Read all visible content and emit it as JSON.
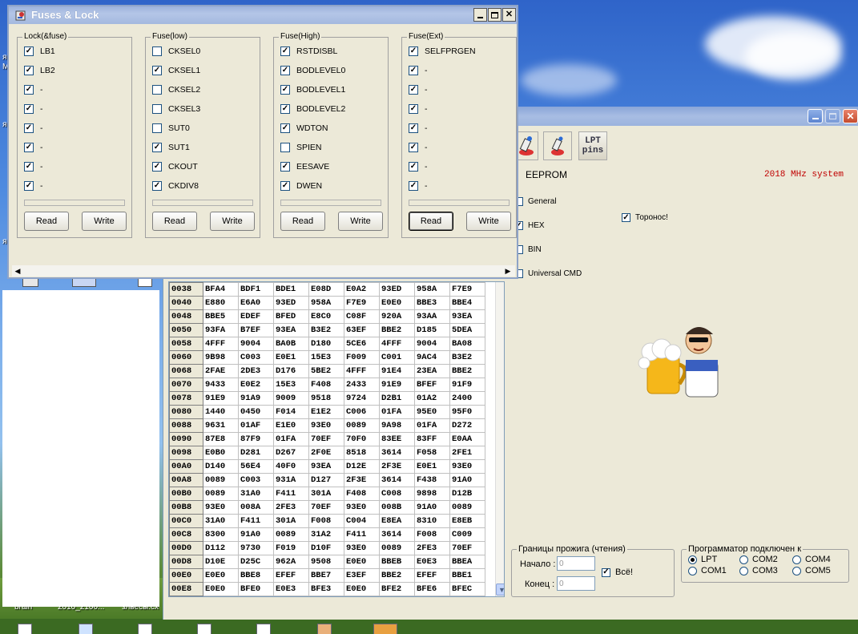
{
  "desktop": {
    "icon_labels": [
      "brain",
      "2010_2100...",
      "злвесы.сх"
    ],
    "side_letters": [
      "я",
      "M",
      "я",
      "я"
    ]
  },
  "main_window": {
    "toolbar": {
      "lpt_line1": "LPT",
      "lpt_line2": "pins"
    },
    "eeprom_label": "EEPROM",
    "system_label": "2018 MHz system",
    "options": [
      {
        "label": "General",
        "checked": false
      },
      {
        "label": "HEX",
        "checked": true
      },
      {
        "label": "BIN",
        "checked": false
      },
      {
        "label": "Universal CMD",
        "checked": false
      }
    ],
    "toronos_label": "Торонос!",
    "hex_rows": [
      {
        "addr": "0038",
        "vals": [
          "BFA4",
          "BDF1",
          "BDE1",
          "E08D",
          "E0A2",
          "93ED",
          "958A",
          "F7E9"
        ]
      },
      {
        "addr": "0040",
        "vals": [
          "E880",
          "E6A0",
          "93ED",
          "958A",
          "F7E9",
          "E0E0",
          "BBE3",
          "BBE4"
        ]
      },
      {
        "addr": "0048",
        "vals": [
          "BBE5",
          "EDEF",
          "BFED",
          "E8C0",
          "C08F",
          "920A",
          "93AA",
          "93EA"
        ]
      },
      {
        "addr": "0050",
        "vals": [
          "93FA",
          "B7EF",
          "93EA",
          "B3E2",
          "63EF",
          "BBE2",
          "D185",
          "5DEA"
        ]
      },
      {
        "addr": "0058",
        "vals": [
          "4FFF",
          "9004",
          "BA0B",
          "D180",
          "5CE6",
          "4FFF",
          "9004",
          "BA08"
        ]
      },
      {
        "addr": "0060",
        "vals": [
          "9B98",
          "C003",
          "E0E1",
          "15E3",
          "F009",
          "C001",
          "9AC4",
          "B3E2"
        ]
      },
      {
        "addr": "0068",
        "vals": [
          "2FAE",
          "2DE3",
          "D176",
          "5BE2",
          "4FFF",
          "91E4",
          "23EA",
          "BBE2"
        ]
      },
      {
        "addr": "0070",
        "vals": [
          "9433",
          "E0E2",
          "15E3",
          "F408",
          "2433",
          "91E9",
          "BFEF",
          "91F9"
        ]
      },
      {
        "addr": "0078",
        "vals": [
          "91E9",
          "91A9",
          "9009",
          "9518",
          "9724",
          "D2B1",
          "01A2",
          "2400"
        ]
      },
      {
        "addr": "0080",
        "vals": [
          "1440",
          "0450",
          "F014",
          "E1E2",
          "C006",
          "01FA",
          "95E0",
          "95F0"
        ]
      },
      {
        "addr": "0088",
        "vals": [
          "9631",
          "01AF",
          "E1E0",
          "93E0",
          "0089",
          "9A98",
          "01FA",
          "D272"
        ]
      },
      {
        "addr": "0090",
        "vals": [
          "87E8",
          "87F9",
          "01FA",
          "70EF",
          "70F0",
          "83EE",
          "83FF",
          "E0AA"
        ]
      },
      {
        "addr": "0098",
        "vals": [
          "E0B0",
          "D281",
          "D267",
          "2F0E",
          "8518",
          "3614",
          "F058",
          "2FE1"
        ]
      },
      {
        "addr": "00A0",
        "vals": [
          "D140",
          "56E4",
          "40F0",
          "93EA",
          "D12E",
          "2F3E",
          "E0E1",
          "93E0"
        ]
      },
      {
        "addr": "00A8",
        "vals": [
          "0089",
          "C003",
          "931A",
          "D127",
          "2F3E",
          "3614",
          "F438",
          "91A0"
        ]
      },
      {
        "addr": "00B0",
        "vals": [
          "0089",
          "31A0",
          "F411",
          "301A",
          "F408",
          "C008",
          "9898",
          "D12B"
        ]
      },
      {
        "addr": "00B8",
        "vals": [
          "93E0",
          "008A",
          "2FE3",
          "70EF",
          "93E0",
          "008B",
          "91A0",
          "0089"
        ]
      },
      {
        "addr": "00C0",
        "vals": [
          "31A0",
          "F411",
          "301A",
          "F008",
          "C004",
          "E8EA",
          "8310",
          "E8EB"
        ]
      },
      {
        "addr": "00C8",
        "vals": [
          "8300",
          "91A0",
          "0089",
          "31A2",
          "F411",
          "3614",
          "F008",
          "C009"
        ]
      },
      {
        "addr": "00D0",
        "vals": [
          "D112",
          "9730",
          "F019",
          "D10F",
          "93E0",
          "0089",
          "2FE3",
          "70EF"
        ]
      },
      {
        "addr": "00D8",
        "vals": [
          "D10E",
          "D25C",
          "962A",
          "9508",
          "E0E0",
          "BBEB",
          "E0E3",
          "BBEA"
        ]
      },
      {
        "addr": "00E0",
        "vals": [
          "E0E0",
          "BBE8",
          "EFEF",
          "BBE7",
          "E3EF",
          "BBE2",
          "EFEF",
          "BBE1"
        ]
      },
      {
        "addr": "00E8",
        "vals": [
          "E0E0",
          "BFE0",
          "E0E3",
          "BFE3",
          "E0E0",
          "BFE2",
          "BFE6",
          "BFEC"
        ]
      }
    ],
    "bounds": {
      "title": "Границы прожига (чтения)",
      "start_label": "Начало :",
      "start_value": "0",
      "end_label": "Конец :",
      "end_value": "0",
      "all_label": "Всё!",
      "all_checked": true
    },
    "programmer": {
      "title": "Программатор подключен к",
      "ports": [
        {
          "label": "LPT",
          "checked": true
        },
        {
          "label": "COM2",
          "checked": false
        },
        {
          "label": "COM4",
          "checked": false
        },
        {
          "label": "COM1",
          "checked": false
        },
        {
          "label": "COM3",
          "checked": false
        },
        {
          "label": "COM5",
          "checked": false
        }
      ]
    }
  },
  "fuses_window": {
    "title": "Fuses & Lock",
    "groups": [
      {
        "title": "Lock(&fuse)",
        "items": [
          {
            "label": "LB1",
            "checked": true
          },
          {
            "label": "LB2",
            "checked": true
          },
          {
            "label": "-",
            "checked": true
          },
          {
            "label": "-",
            "checked": true
          },
          {
            "label": "-",
            "checked": true
          },
          {
            "label": "-",
            "checked": true
          },
          {
            "label": "-",
            "checked": true
          },
          {
            "label": "-",
            "checked": true
          }
        ],
        "read_label": "Read",
        "write_label": "Write"
      },
      {
        "title": "Fuse(low)",
        "items": [
          {
            "label": "CKSEL0",
            "checked": false
          },
          {
            "label": "CKSEL1",
            "checked": true
          },
          {
            "label": "CKSEL2",
            "checked": false
          },
          {
            "label": "CKSEL3",
            "checked": false
          },
          {
            "label": "SUT0",
            "checked": false
          },
          {
            "label": "SUT1",
            "checked": true
          },
          {
            "label": "CKOUT",
            "checked": true
          },
          {
            "label": "CKDIV8",
            "checked": true
          }
        ],
        "read_label": "Read",
        "write_label": "Write"
      },
      {
        "title": "Fuse(High)",
        "items": [
          {
            "label": "RSTDISBL",
            "checked": true
          },
          {
            "label": "BODLEVEL0",
            "checked": true
          },
          {
            "label": "BODLEVEL1",
            "checked": true
          },
          {
            "label": "BODLEVEL2",
            "checked": true
          },
          {
            "label": "WDTON",
            "checked": true
          },
          {
            "label": "SPIEN",
            "checked": false
          },
          {
            "label": "EESAVE",
            "checked": true
          },
          {
            "label": "DWEN",
            "checked": true
          }
        ],
        "read_label": "Read",
        "write_label": "Write"
      },
      {
        "title": "Fuse(Ext)",
        "items": [
          {
            "label": "SELFPRGEN",
            "checked": true
          },
          {
            "label": "-",
            "checked": true
          },
          {
            "label": "-",
            "checked": true
          },
          {
            "label": "-",
            "checked": true
          },
          {
            "label": "-",
            "checked": true
          },
          {
            "label": "-",
            "checked": true
          },
          {
            "label": "-",
            "checked": true
          },
          {
            "label": "-",
            "checked": true
          }
        ],
        "read_label": "Read",
        "write_label": "Write"
      }
    ]
  },
  "colors": {
    "window_face": "#ece9d8",
    "system_label": "#c00000",
    "titlebar_inactive": "#a8bde3"
  }
}
